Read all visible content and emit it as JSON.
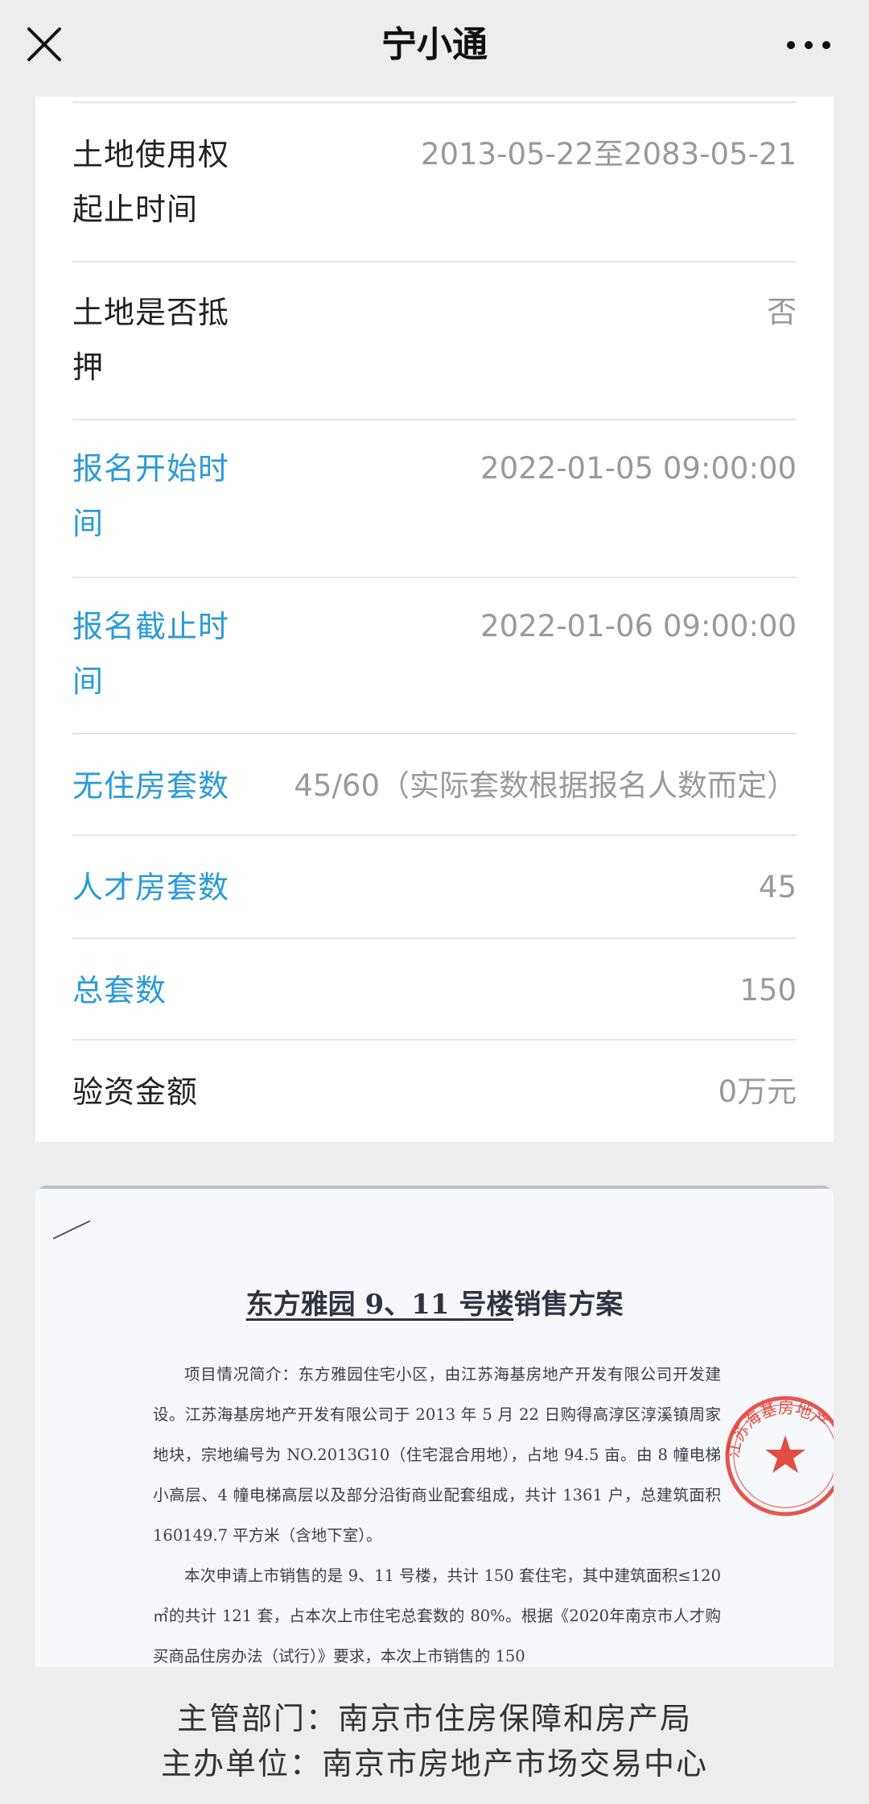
{
  "nav": {
    "title": "宁小通"
  },
  "rows": {
    "land_use_period": {
      "label": "土地使用权起止时间",
      "value": "2013-05-22至2083-05-21"
    },
    "land_mortgage": {
      "label": "土地是否抵押",
      "value": "否"
    },
    "reg_start": {
      "label": "报名开始时间",
      "value": "2022-01-05 09:00:00"
    },
    "reg_end": {
      "label": "报名截止时间",
      "value": "2022-01-06 09:00:00"
    },
    "no_house_units": {
      "label": "无住房套数",
      "value": "45/60（实际套数根据报名人数而定）"
    },
    "talent_units": {
      "label": "人才房套数",
      "value": "45"
    },
    "total_units": {
      "label": "总套数",
      "value": "150"
    },
    "deposit": {
      "label": "验资金额",
      "value": "0万元"
    }
  },
  "document": {
    "title_underlined": "东方雅园 9、11 号楼",
    "title_rest": "销售方案",
    "para1": "项目情况简介：东方雅园住宅小区，由江苏海基房地产开发有限公司开发建设。江苏海基房地产开发有限公司于 2013 年 5 月 22 日购得高淳区淳溪镇周家地块，宗地编号为 NO.2013G10（住宅混合用地），占地 94.5 亩。由 8 幢电梯小高层、4 幢电梯高层以及部分沿街商业配套组成，共计 1361 户，总建筑面积 160149.7 平方米（含地下室）。",
    "para2": "本次申请上市销售的是 9、11 号楼，共计 150 套住宅，其中建筑面积≤120 ㎡的共计 121 套，占本次上市住宅总套数的 80%。根据《2020年南京市人才购买商品住房办法（试行）》要求，本次上市销售的 150",
    "stamp_text": "江苏海基房地产"
  },
  "footer": {
    "line1": "主管部门：南京市住房保障和房产局",
    "line2": "主办单位：南京市房地产市场交易中心"
  },
  "colors": {
    "accent": "#2a9bd7",
    "value_gray": "#9a9a9a",
    "stamp_red": "#e0392f"
  }
}
